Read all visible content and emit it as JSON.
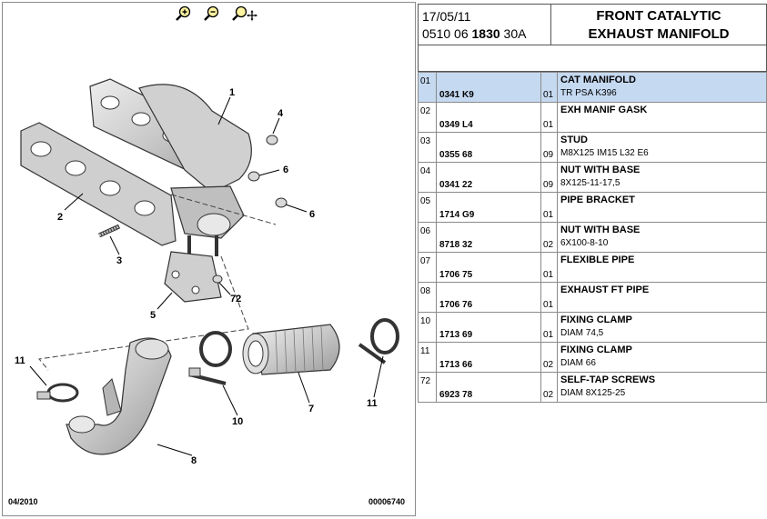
{
  "toolbar": {
    "zoom_in": "zoom-in",
    "zoom_out": "zoom-out",
    "zoom_move": "zoom-pan"
  },
  "footer": {
    "date": "04/2010",
    "ref": "00006740"
  },
  "header": {
    "date": "17/05/11",
    "code_prefix": "0510 06 ",
    "code_bold": "1830",
    "code_suffix": " 30A",
    "title_line1": "FRONT CATALYTIC",
    "title_line2": "EXHAUST MANIFOLD"
  },
  "callouts": [
    "1",
    "2",
    "3",
    "4",
    "5",
    "6",
    "6",
    "7",
    "8",
    "10",
    "11",
    "11",
    "72"
  ],
  "parts": [
    {
      "idx": "01",
      "ref": "0341 K9",
      "qty": "01",
      "name": "CAT MANIFOLD",
      "detail": "TR PSA K396",
      "selected": true
    },
    {
      "idx": "02",
      "ref": "0349 L4",
      "qty": "01",
      "name": "EXH MANIF GASK",
      "detail": ""
    },
    {
      "idx": "03",
      "ref": "0355 68",
      "qty": "09",
      "name": "STUD",
      "detail": "M8X125 IM15 L32 E6"
    },
    {
      "idx": "04",
      "ref": "0341 22",
      "qty": "09",
      "name": "NUT WITH BASE",
      "detail": "8X125-11-17,5"
    },
    {
      "idx": "05",
      "ref": "1714 G9",
      "qty": "01",
      "name": "PIPE BRACKET",
      "detail": ""
    },
    {
      "idx": "06",
      "ref": "8718 32",
      "qty": "02",
      "name": "NUT WITH BASE",
      "detail": "6X100-8-10"
    },
    {
      "idx": "07",
      "ref": "1706 75",
      "qty": "01",
      "name": "FLEXIBLE PIPE",
      "detail": ""
    },
    {
      "idx": "08",
      "ref": "1706 76",
      "qty": "01",
      "name": "EXHAUST FT PIPE",
      "detail": ""
    },
    {
      "idx": "10",
      "ref": "1713 69",
      "qty": "01",
      "name": "FIXING CLAMP",
      "detail": "DIAM 74,5"
    },
    {
      "idx": "11",
      "ref": "1713 66",
      "qty": "02",
      "name": "FIXING CLAMP",
      "detail": "DIAM 66"
    },
    {
      "idx": "72",
      "ref": "6923 78",
      "qty": "02",
      "name": "SELF-TAP SCREWS",
      "detail": "DIAM 8X125-25"
    }
  ],
  "colors": {
    "selected_row": "#c5d9f1",
    "border": "#8a8a8a",
    "part_fill": "#d8d8d8"
  }
}
